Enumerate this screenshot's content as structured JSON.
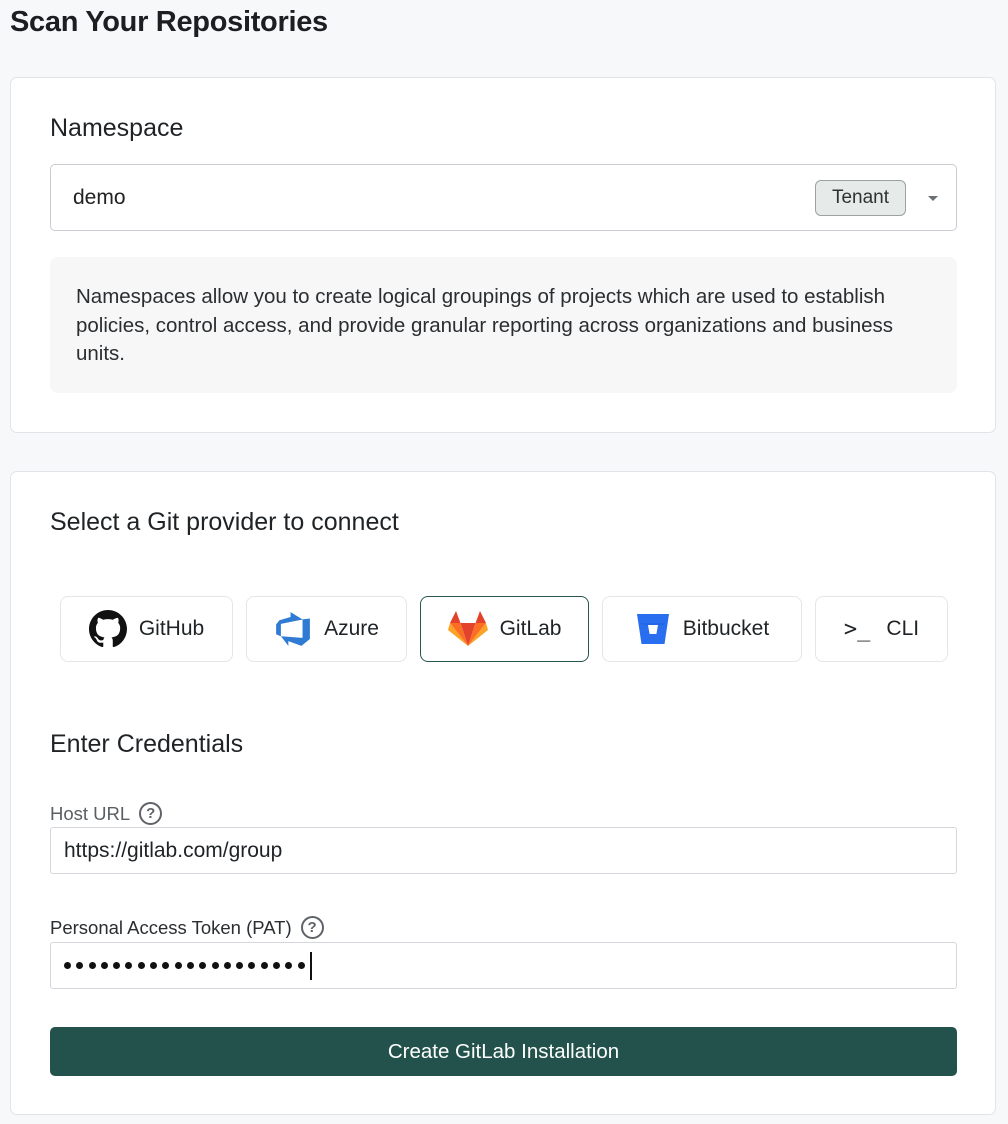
{
  "page_title": "Scan Your Repositories",
  "namespace": {
    "heading": "Namespace",
    "selected_value": "demo",
    "badge": "Tenant",
    "info_text": "Namespaces allow you to create logical groupings of projects which are used to establish policies, control access, and provide granular reporting across organizations and business units."
  },
  "git": {
    "heading": "Select a Git provider to connect",
    "providers": [
      {
        "label": "GitHub",
        "icon": "github-icon",
        "selected": false
      },
      {
        "label": "Azure",
        "icon": "azure-devops-icon",
        "selected": false
      },
      {
        "label": "GitLab",
        "icon": "gitlab-icon",
        "selected": true
      },
      {
        "label": "Bitbucket",
        "icon": "bitbucket-icon",
        "selected": false
      },
      {
        "label": "CLI",
        "icon": "terminal-icon",
        "prompt": ">_",
        "selected": false
      }
    ]
  },
  "credentials": {
    "heading": "Enter Credentials",
    "host_url_label": "Host URL",
    "host_url_value": "https://gitlab.com/group",
    "pat_label": "Personal Access Token (PAT)",
    "pat_masked_length": 20,
    "submit_label": "Create GitLab Installation"
  },
  "colors": {
    "accent": "#22524b",
    "selected_border": "#285550",
    "gitlab_orange": "#e2432a",
    "azure_blue": "#2f7bd4",
    "bitbucket_blue": "#2a6ef0"
  }
}
